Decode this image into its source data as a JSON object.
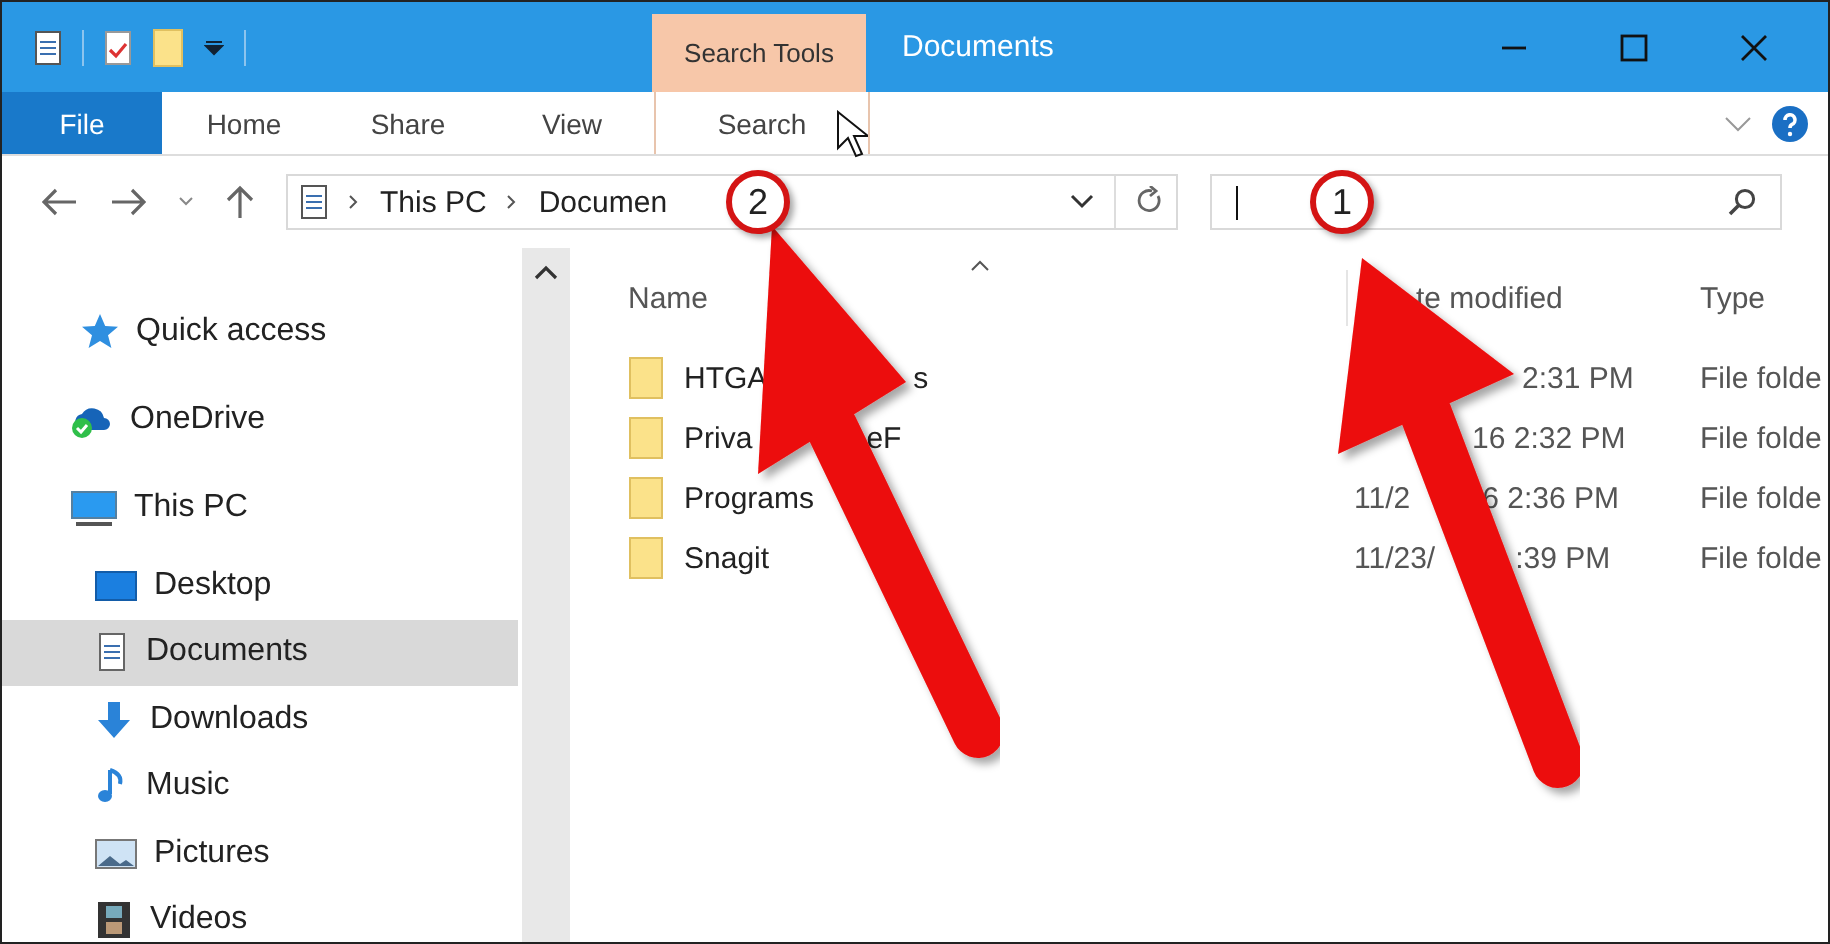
{
  "window": {
    "title": "Documents",
    "context_tab": "Search Tools"
  },
  "ribbon_tabs": [
    {
      "label": "File",
      "kind": "file",
      "selected": false
    },
    {
      "label": "Home",
      "kind": "tab",
      "selected": false
    },
    {
      "label": "Share",
      "kind": "tab",
      "selected": false
    },
    {
      "label": "View",
      "kind": "tab",
      "selected": false
    },
    {
      "label": "Search",
      "kind": "tab",
      "selected": true
    }
  ],
  "address": {
    "crumbs": [
      "This PC",
      "Documen"
    ]
  },
  "sidebar": {
    "items": [
      {
        "label": "Quick access",
        "selected": false
      },
      {
        "label": "OneDrive",
        "selected": false
      },
      {
        "label": "This PC",
        "selected": false,
        "children": [
          {
            "label": "Desktop",
            "selected": false
          },
          {
            "label": "Documents",
            "selected": true
          },
          {
            "label": "Downloads",
            "selected": false
          },
          {
            "label": "Music",
            "selected": false
          },
          {
            "label": "Pictures",
            "selected": false
          },
          {
            "label": "Videos",
            "selected": false
          }
        ]
      }
    ]
  },
  "table": {
    "columns": [
      "Name",
      "te modified",
      "Type"
    ],
    "rows": [
      {
        "name": [
          "HTGA",
          "s"
        ],
        "date": [
          "2:31 PM"
        ],
        "type": "File folde"
      },
      {
        "name": [
          "Priva",
          "eF"
        ],
        "date": [
          "16 2:32 PM"
        ],
        "type": "File folde"
      },
      {
        "name": [
          "Programs"
        ],
        "date": [
          "11/2",
          "6 2:36 PM"
        ],
        "type": "File folde"
      },
      {
        "name": [
          "Snagit"
        ],
        "date": [
          "11/23/",
          ":39 PM"
        ],
        "type": "File folde"
      }
    ]
  },
  "callouts": [
    {
      "label": "2"
    },
    {
      "label": "1"
    }
  ]
}
